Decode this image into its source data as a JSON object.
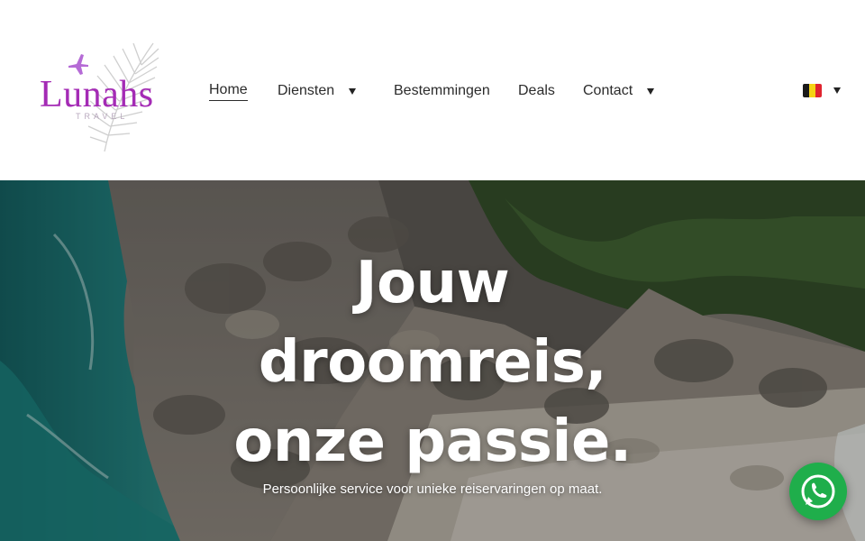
{
  "brand": {
    "name": "Lunahs",
    "tagline": "TRAVEL",
    "color": "#a42bb5"
  },
  "nav": {
    "items": [
      {
        "label": "Home",
        "active": true,
        "has_dropdown": false
      },
      {
        "label": "Diensten",
        "active": false,
        "has_dropdown": true
      },
      {
        "label": "Bestemmingen",
        "active": false,
        "has_dropdown": false
      },
      {
        "label": "Deals",
        "active": false,
        "has_dropdown": false
      },
      {
        "label": "Contact",
        "active": false,
        "has_dropdown": true
      }
    ]
  },
  "language": {
    "flag": "belgium-flag-icon",
    "colors": [
      "#1a1a1a",
      "#f5d314",
      "#e0242f"
    ]
  },
  "hero": {
    "title_lines": [
      "Jouw",
      "droomreis,",
      "onze passie."
    ],
    "subtitle": "Persoonlijke service voor unieke reiservaringen op maat."
  },
  "whatsapp": {
    "icon": "whatsapp-icon",
    "color": "#1fae4b"
  }
}
